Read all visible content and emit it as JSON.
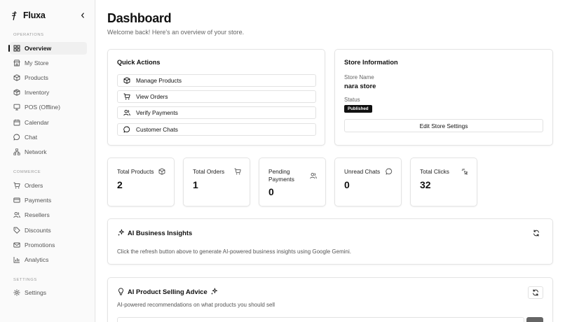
{
  "brand": {
    "name": "Fluxa"
  },
  "sidebar": {
    "sections": [
      {
        "label": "Operations",
        "items": [
          {
            "label": "Overview",
            "icon": "grid-icon",
            "active": true
          },
          {
            "label": "My Store",
            "icon": "store-icon"
          },
          {
            "label": "Products",
            "icon": "package-icon"
          },
          {
            "label": "Inventory",
            "icon": "box-icon"
          },
          {
            "label": "POS (Offline)",
            "icon": "monitor-icon"
          },
          {
            "label": "Calendar",
            "icon": "calendar-icon"
          },
          {
            "label": "Chat",
            "icon": "chat-icon"
          },
          {
            "label": "Network",
            "icon": "network-icon"
          }
        ]
      },
      {
        "label": "Commerce",
        "items": [
          {
            "label": "Orders",
            "icon": "cart-icon"
          },
          {
            "label": "Payments",
            "icon": "credit-card-icon"
          },
          {
            "label": "Resellers",
            "icon": "users-icon"
          },
          {
            "label": "Discounts",
            "icon": "tag-icon"
          },
          {
            "label": "Promotions",
            "icon": "mail-icon"
          },
          {
            "label": "Analytics",
            "icon": "chart-icon"
          }
        ]
      },
      {
        "label": "Settings",
        "items": [
          {
            "label": "Settings",
            "icon": "gear-icon"
          }
        ]
      }
    ]
  },
  "header": {
    "title": "Dashboard",
    "subtitle": "Welcome back! Here's an overview of your store."
  },
  "quick_actions": {
    "title": "Quick Actions",
    "items": [
      {
        "label": "Manage Products",
        "icon": "package-icon"
      },
      {
        "label": "View Orders",
        "icon": "cart-icon"
      },
      {
        "label": "Verify Payments",
        "icon": "users-icon"
      },
      {
        "label": "Customer Chats",
        "icon": "chat-icon"
      }
    ]
  },
  "store_info": {
    "title": "Store Information",
    "name_label": "Store Name",
    "name_value": "nara store",
    "status_label": "Status",
    "status_value": "Published",
    "edit_button": "Edit Store Settings"
  },
  "stats": [
    {
      "label": "Total Products",
      "value": "2",
      "icon": "package-icon"
    },
    {
      "label": "Total Orders",
      "value": "1",
      "icon": "cart-icon"
    },
    {
      "label": "Pending Payments",
      "value": "0",
      "icon": "users-icon"
    },
    {
      "label": "Unread Chats",
      "value": "0",
      "icon": "chat-icon"
    },
    {
      "label": "Total Clicks",
      "value": "32",
      "icon": "cursor-click-icon"
    }
  ],
  "ai_insights": {
    "title": "AI Business Insights",
    "text": "Click the refresh button above to generate AI-powered business insights using Google Gemini."
  },
  "ai_advice": {
    "title": "AI Product Selling Advice",
    "text": "AI-powered recommendations on what products you should sell"
  }
}
